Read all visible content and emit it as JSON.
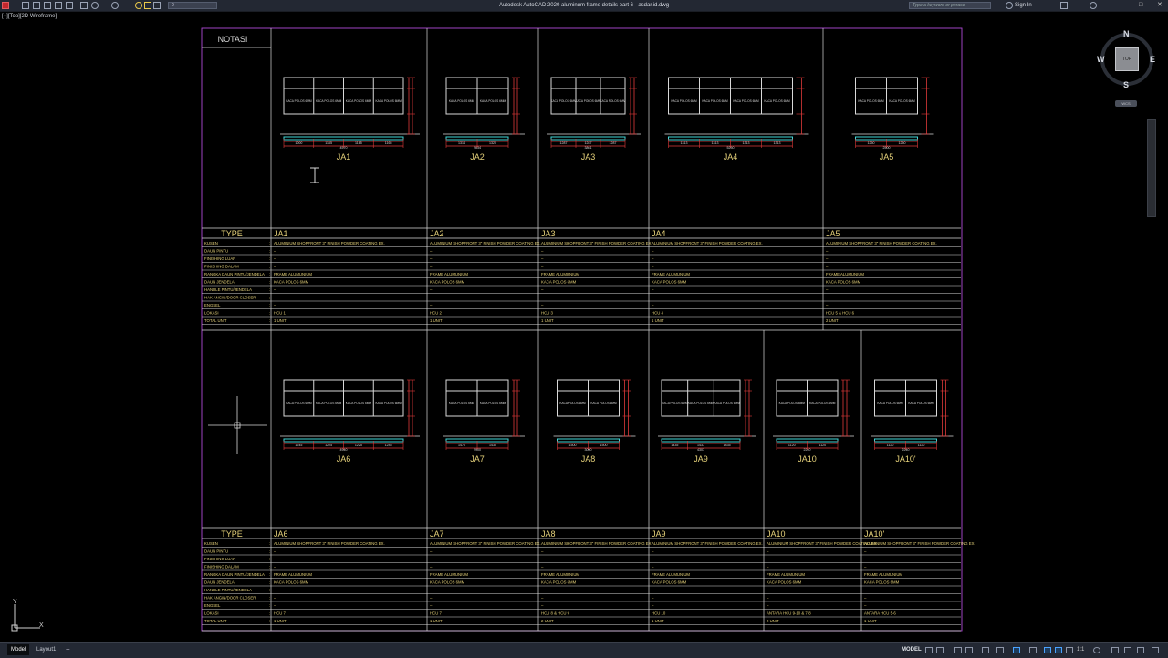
{
  "app": {
    "title": "Autodesk AutoCAD 2020    aluminum frame details part 6 - asdar.id.dwg",
    "layer_value": "0",
    "search_placeholder": "Type a keyword or phrase",
    "sign_in": "Sign In",
    "view_label": "[−][Top][2D Wireframe]"
  },
  "viewcube": {
    "top": "TOP",
    "n": "N",
    "s": "S",
    "e": "E",
    "w": "W",
    "wcs": "WCS"
  },
  "ucs": {
    "x": "X",
    "y": "Y"
  },
  "status": {
    "tabs": [
      "Model",
      "Layout1"
    ],
    "model_label": "MODEL",
    "scale": "1:1"
  },
  "sheet": {
    "notasi": "NOTASI",
    "type_label": "TYPE",
    "row_labels": [
      "KUSEN",
      "DAUN PINTU",
      "FINISHING LUAR",
      "FINISHING DALAM",
      "RANGKA DAUN PINTU/JENDELA",
      "DAUN JENDELA",
      "HANDLE PINTU/JENDELA",
      "HAK ANGIN/DOOR CLOSER",
      "ENGSEL",
      "LOKASI",
      "TOTAL UNIT"
    ],
    "glass_label": "KACA POLOS 6MM",
    "row1": [
      {
        "name": "JA1",
        "panes": 4,
        "kusen": "ALUMINIUM SHOPFRONT 3\" FINISH POWDER COATING EX.",
        "rangka": "FRAME ALUMUNIUM",
        "daun": "KACA POLOS 6MM",
        "lokasi": "HCU 1",
        "total": "1 UNIT",
        "dims": [
          "1000",
          "1165",
          "1165",
          "1165"
        ],
        "total_dim": "4570"
      },
      {
        "name": "JA2",
        "panes": 2,
        "kusen": "ALUMINIUM SHOPFRONT 3\" FINISH POWDER COATING EX.",
        "rangka": "FRAME ALUMUNIUM",
        "daun": "KACA POLOS 6MM",
        "lokasi": "HCU 2",
        "total": "1 UNIT",
        "dims": [
          "1314",
          "1320"
        ],
        "total_dim": "2634"
      },
      {
        "name": "JA3",
        "panes": 3,
        "kusen": "ALUMINIUM SHOPFRONT 3\" FINISH POWDER COATING EX.",
        "rangka": "FRAME ALUMUNIUM",
        "daun": "KACA POLOS 6MM",
        "lokasi": "HCU 3",
        "total": "1 UNIT",
        "dims": [
          "1287",
          "1287",
          "1287"
        ],
        "total_dim": "3861"
      },
      {
        "name": "JA4",
        "panes": 4,
        "kusen": "ALUMINIUM SHOPFRONT 3\" FINISH POWDER COATING EX.",
        "rangka": "FRAME ALUMUNIUM",
        "daun": "KACA POLOS 6MM",
        "lokasi": "HCU 4",
        "total": "1 UNIT",
        "dims": [
          "1313",
          "1313",
          "1313",
          "1313"
        ],
        "total_dim": "5250"
      },
      {
        "name": "JA5",
        "panes": 2,
        "kusen": "ALUMINIUM SHOPFRONT 3\" FINISH POWDER COATING EX.",
        "rangka": "FRAME ALUMUNIUM",
        "daun": "KACA POLOS 6MM",
        "lokasi": "HCU 5 & HCU 6",
        "total": "2 UNIT",
        "dims": [
          "1250",
          "1250"
        ],
        "total_dim": "2500"
      }
    ],
    "row2": [
      {
        "name": "JA6",
        "panes": 4,
        "kusen": "ALUMINIUM SHOPFRONT 3\" FINISH POWDER COATING EX.",
        "rangka": "FRAME ALUMUNIUM",
        "daun": "KACA POLOS 6MM",
        "lokasi": "HCU 7",
        "total": "1 UNIT",
        "dims": [
          "1245",
          "1225",
          "1225",
          "1245"
        ],
        "total_dim": "4940"
      },
      {
        "name": "JA7",
        "panes": 2,
        "kusen": "ALUMINIUM SHOPFRONT 3\" FINISH POWDER COATING EX.",
        "rangka": "FRAME ALUMUNIUM",
        "daun": "KACA POLOS 6MM",
        "lokasi": "HCU 7",
        "total": "1 UNIT",
        "dims": [
          "1470",
          "1430"
        ],
        "total_dim": "2900"
      },
      {
        "name": "JA8",
        "panes": 2,
        "kusen": "ALUMINIUM SHOPFRONT 3\" FINISH POWDER COATING EX.",
        "rangka": "FRAME ALUMUNIUM",
        "daun": "KACA POLOS 6MM",
        "lokasi": "HCU 8 & HCU 9",
        "total": "2 UNIT",
        "dims": [
          "1500",
          "1500"
        ],
        "total_dim": "3000"
      },
      {
        "name": "JA9",
        "panes": 3,
        "kusen": "ALUMINIUM SHOPFRONT 3\" FINISH POWDER COATING EX.",
        "rangka": "FRAME ALUMUNIUM",
        "daun": "KACA POLOS 6MM",
        "lokasi": "HCU 10",
        "total": "1 UNIT",
        "dims": [
          "1435",
          "1437",
          "1435"
        ],
        "total_dim": "4307"
      },
      {
        "name": "JA10",
        "panes": 2,
        "kusen": "ALUMINIUM SHOPFRONT 3\" FINISH POWDER COATING EX.",
        "rangka": "FRAME ALUMUNIUM",
        "daun": "KACA POLOS 6MM",
        "lokasi": "ANTARA HCU 9-10 & 7-8",
        "total": "2 UNIT",
        "dims": [
          "1120",
          "1120"
        ],
        "total_dim": "2240"
      },
      {
        "name": "JA10'",
        "panes": 2,
        "kusen": "ALUMINIUM SHOPFRONT 3\" FINISH POWDER COATING EX.",
        "rangka": "FRAME ALUMUNIUM",
        "daun": "KACA POLOS 6MM",
        "lokasi": "ANTARA HCU 5-6",
        "total": "1 UNIT",
        "dims": [
          "1120",
          "1120"
        ],
        "total_dim": "2240"
      }
    ]
  }
}
